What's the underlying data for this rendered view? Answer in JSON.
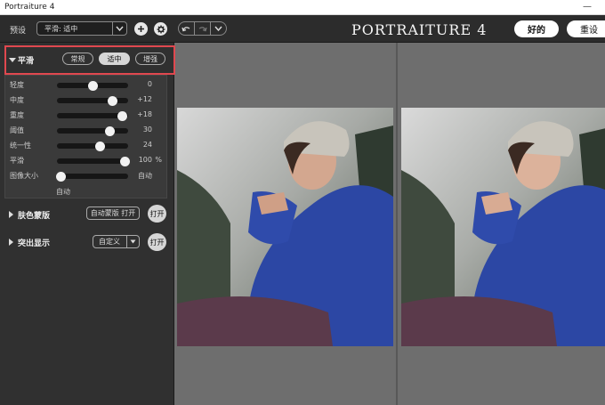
{
  "window": {
    "title": "Portraiture 4",
    "minimize": "—"
  },
  "toolbar": {
    "preset_label": "预设",
    "preset_value": "平滑: 适中",
    "logo": "PORTRAITURE 4",
    "ok": "好的",
    "reset": "重设"
  },
  "smooth": {
    "title": "平滑",
    "modes": [
      "常规",
      "适中",
      "增强"
    ],
    "active_mode": "适中",
    "sliders": [
      {
        "label": "轻度",
        "value": "0",
        "fraction": 0.5
      },
      {
        "label": "中度",
        "value": "+12",
        "fraction": 0.78
      },
      {
        "label": "重度",
        "value": "+18",
        "fraction": 0.92
      },
      {
        "label": "阈值",
        "value": "30",
        "fraction": 0.74
      },
      {
        "label": "统一性",
        "value": "24",
        "fraction": 0.6
      },
      {
        "label": "平滑",
        "value": "100",
        "unit": "%",
        "fraction": 0.95
      },
      {
        "label": "图像大小",
        "value": "自动",
        "fraction": 0.05
      }
    ],
    "auto_label": "自动"
  },
  "skin_mask": {
    "title": "肤色蒙版",
    "button": "自动蒙版 打开",
    "toggle": "打开"
  },
  "enhance": {
    "title": "突出显示",
    "select_value": "自定义",
    "toggle": "打开"
  },
  "colors": {
    "highlight": "#e0484f",
    "panel": "#303030",
    "canvas": "#6e6e6e"
  }
}
